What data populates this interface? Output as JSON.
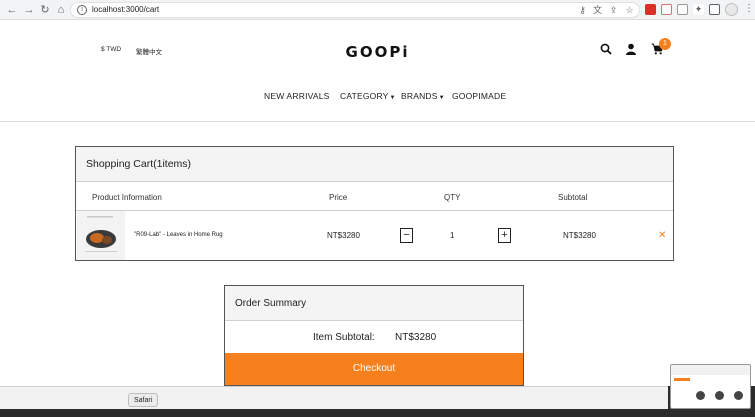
{
  "browser": {
    "url": "localhost:3000/cart",
    "back_icon": "back-arrow-icon",
    "forward_icon": "forward-arrow-icon",
    "reload_icon": "reload-icon",
    "home_icon": "home-icon"
  },
  "header": {
    "currency": "$ TWD",
    "language": "繁體中文",
    "logo": "GOOPi",
    "cart_count": "1",
    "accent_color": "#f7801e"
  },
  "nav": {
    "items": [
      {
        "label": "NEW ARRIVALS"
      },
      {
        "label": "CATEGORY"
      },
      {
        "label": "BRANDS"
      },
      {
        "label": "GOOPIMADE"
      }
    ]
  },
  "cart": {
    "title": "Shopping Cart(1items)",
    "columns": [
      "Product Information",
      "Price",
      "QTY",
      "Subtotal"
    ],
    "items": [
      {
        "name": "\"R09-Lab\" - Leaves in Home Rug",
        "price": "NT$3280",
        "qty": "1",
        "subtotal": "NT$3280"
      }
    ],
    "decrease_label": "−",
    "increase_label": "+",
    "remove_label": "✕"
  },
  "summary": {
    "title": "Order Summary",
    "item_subtotal_label": "Item Subtotal:",
    "item_subtotal_value": "NT$3280",
    "checkout_label": "Checkout"
  },
  "dock": {
    "tooltip": "Safari"
  }
}
